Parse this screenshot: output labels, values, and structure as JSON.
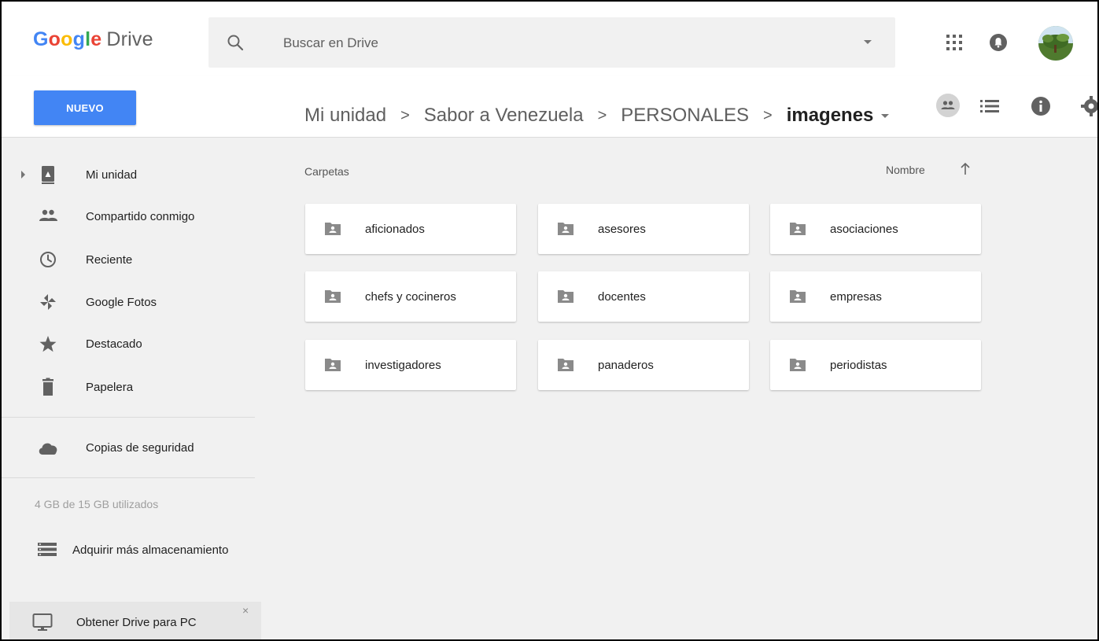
{
  "app": {
    "logo_google": "Google",
    "logo_product": "Drive"
  },
  "search": {
    "placeholder": "Buscar en Drive",
    "value": ""
  },
  "toolbar": {
    "new_label": "NUEVO"
  },
  "breadcrumb": [
    "Mi unidad",
    "Sabor a Venezuela",
    "PERSONALES",
    "imagenes"
  ],
  "breadcrumb_separator": ">",
  "sidebar": {
    "items": [
      {
        "label": "Mi unidad",
        "icon": "drive-icon"
      },
      {
        "label": "Compartido conmigo",
        "icon": "people-icon"
      },
      {
        "label": "Reciente",
        "icon": "clock-icon"
      },
      {
        "label": "Google Fotos",
        "icon": "pinwheel-icon"
      },
      {
        "label": "Destacado",
        "icon": "star-icon"
      },
      {
        "label": "Papelera",
        "icon": "trash-icon"
      },
      {
        "label": "Copias de seguridad",
        "icon": "cloud-icon"
      }
    ],
    "storage_text": "4 GB de 15 GB utilizados",
    "storage_link": "Adquirir más almacenamiento",
    "promo_text": "Obtener Drive para PC",
    "promo_close": "×"
  },
  "main": {
    "section_label": "Carpetas",
    "sort_label": "Nombre",
    "folders": [
      "aficionados",
      "asesores",
      "asociaciones",
      "chefs y cocineros",
      "docentes",
      "empresas",
      "investigadores",
      "panaderos",
      "periodistas"
    ]
  },
  "colors": {
    "primary": "#4285f4",
    "background": "#f1f1f1",
    "icon": "#757575"
  }
}
